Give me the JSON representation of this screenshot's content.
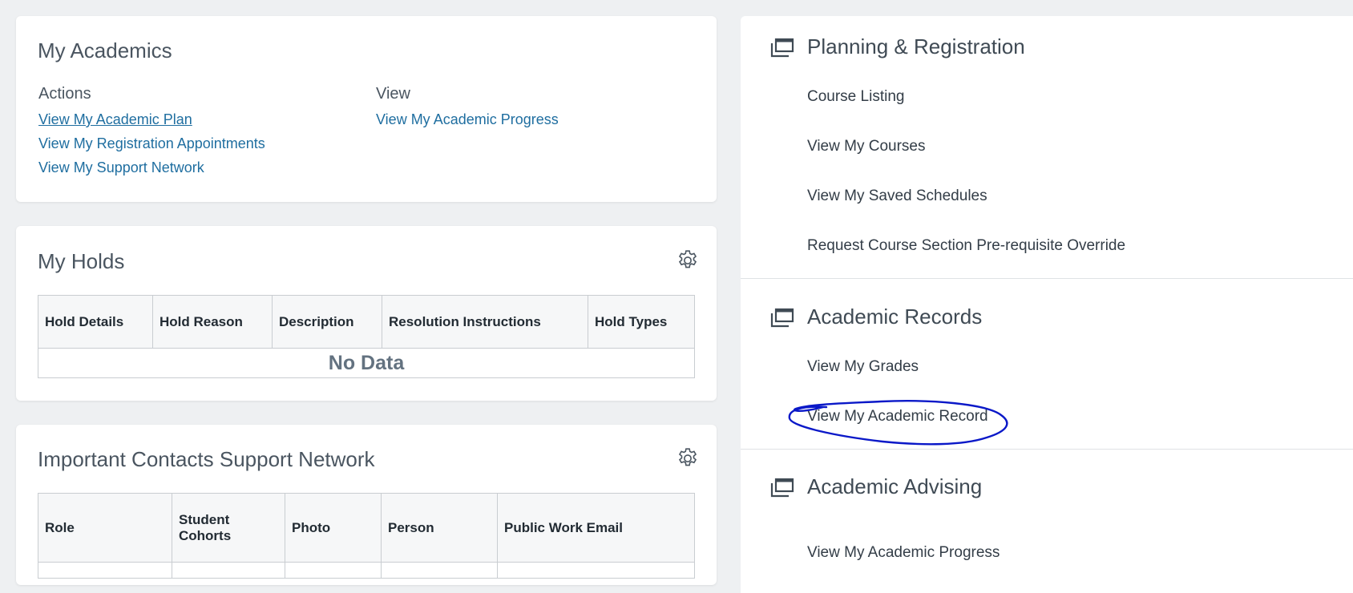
{
  "my_academics": {
    "title": "My Academics",
    "actions_heading": "Actions",
    "view_heading": "View",
    "actions": [
      "View My Academic Plan",
      "View My Registration Appointments",
      "View My Support Network"
    ],
    "view_links": [
      "View My Academic Progress"
    ]
  },
  "my_holds": {
    "title": "My Holds",
    "columns": [
      "Hold Details",
      "Hold Reason",
      "Description",
      "Resolution Instructions",
      "Hold Types"
    ],
    "empty_text": "No Data"
  },
  "contacts": {
    "title": "Important Contacts Support Network",
    "columns": [
      "Role",
      "Student Cohorts",
      "Photo",
      "Person",
      "Public Work Email"
    ]
  },
  "right_panel": {
    "sections": [
      {
        "title": "Planning & Registration",
        "links": [
          "Course Listing",
          "View My Courses",
          "View My Saved Schedules",
          "Request Course Section Pre-requisite Override"
        ]
      },
      {
        "title": "Academic Records",
        "links": [
          "View My Grades",
          "View My Academic Record"
        ]
      },
      {
        "title": "Academic Advising",
        "links": [
          "View My Academic Progress"
        ]
      }
    ]
  },
  "icons": {
    "settings": "gear-icon",
    "section": "stacked-windows-icon"
  },
  "colors": {
    "link": "#1f6ea0",
    "background": "#eef0f2",
    "annotation": "#0a18c8"
  }
}
